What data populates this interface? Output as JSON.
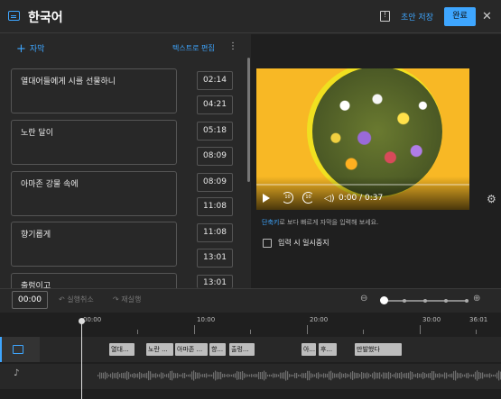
{
  "header": {
    "title": "한국어",
    "draft_label": "초안 저장",
    "done_label": "완료"
  },
  "left": {
    "add_label": "자막",
    "edit_text_label": "텍스트로 편집",
    "cues": [
      {
        "text": "열대어들에게 시를 선물하니",
        "start": "02:14",
        "end": "04:21"
      },
      {
        "text": "노란 달이",
        "start": "05:18",
        "end": "08:09"
      },
      {
        "text": "아마존 강물 속에",
        "start": "08:09",
        "end": "11:08"
      },
      {
        "text": "향기롭게",
        "start": "11:08",
        "end": "13:01"
      },
      {
        "text": "출렁이고",
        "start": "13:01",
        "end": ""
      }
    ]
  },
  "player": {
    "time_display": "0:00 / 0:37",
    "rewind_label": "10",
    "forward_label": "10"
  },
  "hint": {
    "link": "단축키",
    "rest": "로 보다 빠르게 자막을 입력해 보세요."
  },
  "pause_while_typing": "입력 시 일시중지",
  "toolbar": {
    "current_time": "00:00",
    "undo_label": "실행취소",
    "redo_label": "재실행"
  },
  "timeline": {
    "ticks": [
      "00:00",
      "10:00",
      "20:00",
      "30:00",
      "36:01"
    ],
    "blocks": [
      "열대...",
      "노란 ...",
      "아마존 ...",
      "향...",
      "출렁...",
      "아...",
      "후...",
      "만발했다"
    ]
  },
  "colors": {
    "accent": "#3ea6ff",
    "video_background": "#f8b825"
  },
  "icons": {
    "subtitles": "subtitles-icon",
    "feedback": "feedback-icon",
    "close": "close-icon",
    "play": "play-icon",
    "settings": "settings-icon",
    "audio": "music-note-icon"
  }
}
